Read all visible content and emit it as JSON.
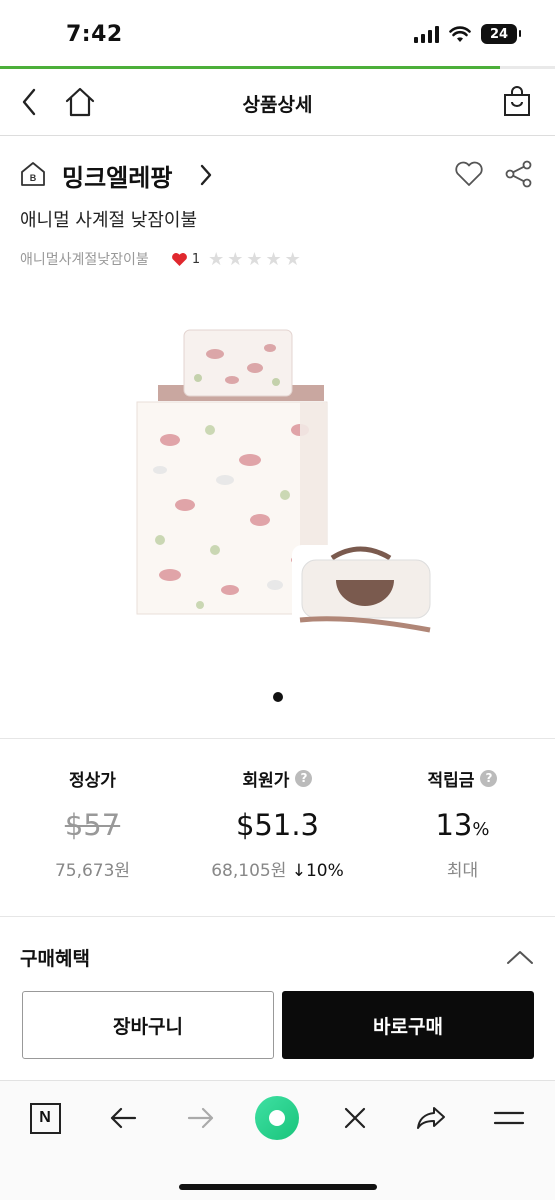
{
  "status_bar": {
    "time": "7:42",
    "battery": "24"
  },
  "page_progress": 0.9,
  "header": {
    "title": "상품상세"
  },
  "brand": {
    "name": "밍크엘레팡"
  },
  "product": {
    "name": "애니멀 사계절 낮잠이불",
    "tag": "애니멀사계절낮잠이불",
    "like_count": "1",
    "rating": 0,
    "image_count": 1,
    "current_image": 1
  },
  "price": {
    "regular": {
      "label": "정상가",
      "usd": "$57",
      "krw": "75,673원"
    },
    "member": {
      "label": "회원가",
      "usd": "$51.3",
      "krw": "68,105원",
      "discount": "↓10%"
    },
    "points": {
      "label": "적립금",
      "value": "13",
      "unit": "%",
      "note": "최대"
    }
  },
  "benefits": {
    "title": "구매혜택"
  },
  "actions": {
    "cart": "장바구니",
    "buy": "바로구매"
  },
  "browser_toolbar": {
    "icons": [
      "naver-n-icon",
      "back-arrow-icon",
      "forward-arrow-icon",
      "green-circle-icon",
      "close-icon",
      "share-arrow-icon",
      "menu-icon"
    ],
    "n_label": "N"
  },
  "colors": {
    "accent_green": "#4caf3a",
    "heart_red": "#e0282e",
    "buy_button": "#0b0b0b"
  }
}
